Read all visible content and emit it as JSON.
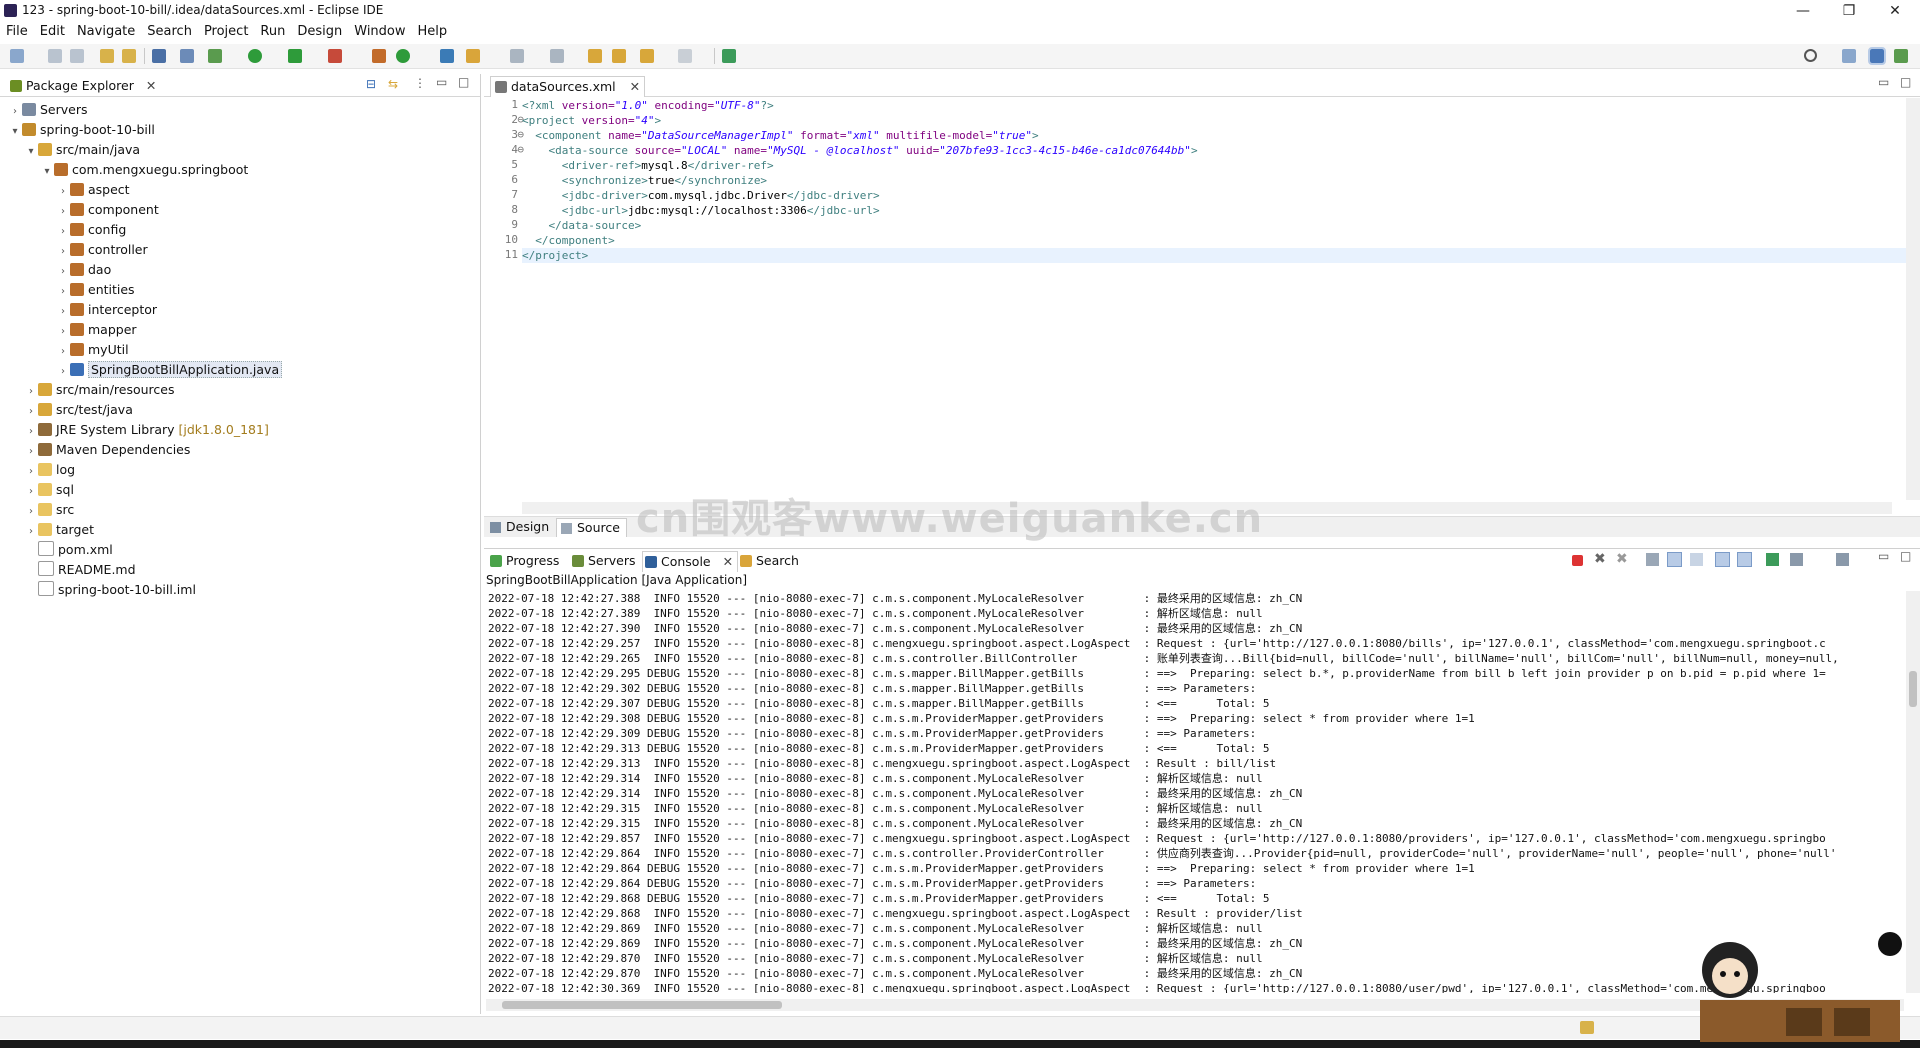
{
  "window": {
    "title": "123 - spring-boot-10-bill/.idea/dataSources.xml - Eclipse IDE"
  },
  "menu": [
    "File",
    "Edit",
    "Navigate",
    "Search",
    "Project",
    "Run",
    "Design",
    "Window",
    "Help"
  ],
  "explorer": {
    "tab": "Package Explorer",
    "items": [
      {
        "label": "Servers",
        "indent": 0,
        "arrow": "right",
        "icon": "ic-server"
      },
      {
        "label": "spring-boot-10-bill",
        "indent": 0,
        "arrow": "down",
        "icon": "ic-project"
      },
      {
        "label": "src/main/java",
        "indent": 1,
        "arrow": "down",
        "icon": "ic-srcfolder"
      },
      {
        "label": "com.mengxuegu.springboot",
        "indent": 2,
        "arrow": "down",
        "icon": "ic-package"
      },
      {
        "label": "aspect",
        "indent": 3,
        "arrow": "right",
        "icon": "ic-package"
      },
      {
        "label": "component",
        "indent": 3,
        "arrow": "right",
        "icon": "ic-package"
      },
      {
        "label": "config",
        "indent": 3,
        "arrow": "right",
        "icon": "ic-package"
      },
      {
        "label": "controller",
        "indent": 3,
        "arrow": "right",
        "icon": "ic-package"
      },
      {
        "label": "dao",
        "indent": 3,
        "arrow": "right",
        "icon": "ic-package"
      },
      {
        "label": "entities",
        "indent": 3,
        "arrow": "right",
        "icon": "ic-package"
      },
      {
        "label": "interceptor",
        "indent": 3,
        "arrow": "right",
        "icon": "ic-package"
      },
      {
        "label": "mapper",
        "indent": 3,
        "arrow": "right",
        "icon": "ic-package"
      },
      {
        "label": "myUtil",
        "indent": 3,
        "arrow": "right",
        "icon": "ic-package"
      },
      {
        "label": "SpringBootBillApplication.java",
        "indent": 3,
        "arrow": "right",
        "icon": "ic-java",
        "selected": true
      },
      {
        "label": "src/main/resources",
        "indent": 1,
        "arrow": "right",
        "icon": "ic-srcfolder"
      },
      {
        "label": "src/test/java",
        "indent": 1,
        "arrow": "right",
        "icon": "ic-srcfolder"
      },
      {
        "label": "JRE System Library",
        "decor": "[jdk1.8.0_181]",
        "indent": 1,
        "arrow": "right",
        "icon": "ic-lib"
      },
      {
        "label": "Maven Dependencies",
        "indent": 1,
        "arrow": "right",
        "icon": "ic-lib"
      },
      {
        "label": "log",
        "indent": 1,
        "arrow": "right",
        "icon": "ic-folder"
      },
      {
        "label": "sql",
        "indent": 1,
        "arrow": "right",
        "icon": "ic-folder"
      },
      {
        "label": "src",
        "indent": 1,
        "arrow": "right",
        "icon": "ic-folder"
      },
      {
        "label": "target",
        "indent": 1,
        "arrow": "right",
        "icon": "ic-folder"
      },
      {
        "label": "pom.xml",
        "indent": 1,
        "arrow": "",
        "icon": "ic-file"
      },
      {
        "label": "README.md",
        "indent": 1,
        "arrow": "",
        "icon": "ic-file"
      },
      {
        "label": "spring-boot-10-bill.iml",
        "indent": 1,
        "arrow": "",
        "icon": "ic-file"
      }
    ]
  },
  "editor": {
    "tab": "dataSources.xml",
    "line_numbers": [
      "1",
      "2",
      "3",
      "4",
      "5",
      "6",
      "7",
      "8",
      "9",
      "10",
      "11"
    ],
    "fold_markers": {
      "2": "⊖",
      "3": "⊖",
      "4": "⊖"
    },
    "lines": [
      [
        [
          "tag",
          "<?xml "
        ],
        [
          "attr",
          "version="
        ],
        [
          "val",
          "\"1.0\""
        ],
        [
          "attr",
          " encoding="
        ],
        [
          "val",
          "\"UTF-8\""
        ],
        [
          "tag",
          "?>"
        ]
      ],
      [
        [
          "tag",
          "<project "
        ],
        [
          "attr",
          "version="
        ],
        [
          "val",
          "\"4\""
        ],
        [
          "tag",
          ">"
        ]
      ],
      [
        [
          "tag",
          "  <component "
        ],
        [
          "attr",
          "name="
        ],
        [
          "val",
          "\"DataSourceManagerImpl\""
        ],
        [
          "attr",
          " format="
        ],
        [
          "val",
          "\"xml\""
        ],
        [
          "attr",
          " multifile-model="
        ],
        [
          "val",
          "\"true\""
        ],
        [
          "tag",
          ">"
        ]
      ],
      [
        [
          "tag",
          "    <data-source "
        ],
        [
          "attr",
          "source="
        ],
        [
          "val",
          "\"LOCAL\""
        ],
        [
          "attr",
          " name="
        ],
        [
          "val",
          "\"MySQL - @localhost\""
        ],
        [
          "attr",
          " uuid="
        ],
        [
          "val",
          "\"207bfe93-1cc3-4c15-b46e-ca1dc07644bb\""
        ],
        [
          "tag",
          ">"
        ]
      ],
      [
        [
          "tag",
          "      <driver-ref>"
        ],
        [
          "txt",
          "mysql.8"
        ],
        [
          "tag",
          "</driver-ref>"
        ]
      ],
      [
        [
          "tag",
          "      <synchronize>"
        ],
        [
          "txt",
          "true"
        ],
        [
          "tag",
          "</synchronize>"
        ]
      ],
      [
        [
          "tag",
          "      <jdbc-driver>"
        ],
        [
          "txt",
          "com.mysql.jdbc.Driver"
        ],
        [
          "tag",
          "</jdbc-driver>"
        ]
      ],
      [
        [
          "tag",
          "      <jdbc-url>"
        ],
        [
          "txt",
          "jdbc:mysql://localhost:3306"
        ],
        [
          "tag",
          "</jdbc-url>"
        ]
      ],
      [
        [
          "tag",
          "    </data-source>"
        ]
      ],
      [
        [
          "tag",
          "  </component>"
        ]
      ],
      [
        [
          "tag",
          "</project>"
        ]
      ]
    ],
    "bottom_tabs": [
      "Design",
      "Source"
    ]
  },
  "console": {
    "tabs": [
      "Progress",
      "Servers",
      "Console",
      "Search"
    ],
    "description": "SpringBootBillApplication [Java Application]",
    "lines": [
      "2022-07-18 12:42:27.388  INFO 15520 --- [nio-8080-exec-7] c.m.s.component.MyLocaleResolver         : 最终采用的区域信息: zh_CN",
      "2022-07-18 12:42:27.389  INFO 15520 --- [nio-8080-exec-7] c.m.s.component.MyLocaleResolver         : 解析区域信息: null",
      "2022-07-18 12:42:27.390  INFO 15520 --- [nio-8080-exec-7] c.m.s.component.MyLocaleResolver         : 最终采用的区域信息: zh_CN",
      "2022-07-18 12:42:29.257  INFO 15520 --- [nio-8080-exec-8] c.mengxuegu.springboot.aspect.LogAspect  : Request : {url='http://127.0.0.1:8080/bills', ip='127.0.0.1', classMethod='com.mengxuegu.springboot.c",
      "2022-07-18 12:42:29.265  INFO 15520 --- [nio-8080-exec-8] c.m.s.controller.BillController          : 账单列表查询...Bill{bid=null, billCode='null', billName='null', billCom='null', billNum=null, money=null,",
      "2022-07-18 12:42:29.295 DEBUG 15520 --- [nio-8080-exec-8] c.m.s.mapper.BillMapper.getBills         : ==>  Preparing: select b.*, p.providerName from bill b left join provider p on b.pid = p.pid where 1=",
      "2022-07-18 12:42:29.302 DEBUG 15520 --- [nio-8080-exec-8] c.m.s.mapper.BillMapper.getBills         : ==> Parameters: ",
      "2022-07-18 12:42:29.307 DEBUG 15520 --- [nio-8080-exec-8] c.m.s.mapper.BillMapper.getBills         : <==      Total: 5",
      "2022-07-18 12:42:29.308 DEBUG 15520 --- [nio-8080-exec-8] c.m.s.m.ProviderMapper.getProviders      : ==>  Preparing: select * from provider where 1=1",
      "2022-07-18 12:42:29.309 DEBUG 15520 --- [nio-8080-exec-8] c.m.s.m.ProviderMapper.getProviders      : ==> Parameters: ",
      "2022-07-18 12:42:29.313 DEBUG 15520 --- [nio-8080-exec-8] c.m.s.m.ProviderMapper.getProviders      : <==      Total: 5",
      "2022-07-18 12:42:29.313  INFO 15520 --- [nio-8080-exec-8] c.mengxuegu.springboot.aspect.LogAspect  : Result : bill/list",
      "2022-07-18 12:42:29.314  INFO 15520 --- [nio-8080-exec-8] c.m.s.component.MyLocaleResolver         : 解析区域信息: null",
      "2022-07-18 12:42:29.314  INFO 15520 --- [nio-8080-exec-8] c.m.s.component.MyLocaleResolver         : 最终采用的区域信息: zh_CN",
      "2022-07-18 12:42:29.315  INFO 15520 --- [nio-8080-exec-8] c.m.s.component.MyLocaleResolver         : 解析区域信息: null",
      "2022-07-18 12:42:29.315  INFO 15520 --- [nio-8080-exec-8] c.m.s.component.MyLocaleResolver         : 最终采用的区域信息: zh_CN",
      "2022-07-18 12:42:29.857  INFO 15520 --- [nio-8080-exec-7] c.mengxuegu.springboot.aspect.LogAspect  : Request : {url='http://127.0.0.1:8080/providers', ip='127.0.0.1', classMethod='com.mengxuegu.springbo",
      "2022-07-18 12:42:29.864  INFO 15520 --- [nio-8080-exec-7] c.m.s.controller.ProviderController      : 供应商列表查询...Provider{pid=null, providerCode='null', providerName='null', people='null', phone='null'",
      "2022-07-18 12:42:29.864 DEBUG 15520 --- [nio-8080-exec-7] c.m.s.m.ProviderMapper.getProviders      : ==>  Preparing: select * from provider where 1=1",
      "2022-07-18 12:42:29.864 DEBUG 15520 --- [nio-8080-exec-7] c.m.s.m.ProviderMapper.getProviders      : ==> Parameters: ",
      "2022-07-18 12:42:29.868 DEBUG 15520 --- [nio-8080-exec-7] c.m.s.m.ProviderMapper.getProviders      : <==      Total: 5",
      "2022-07-18 12:42:29.868  INFO 15520 --- [nio-8080-exec-7] c.mengxuegu.springboot.aspect.LogAspect  : Result : provider/list",
      "2022-07-18 12:42:29.869  INFO 15520 --- [nio-8080-exec-7] c.m.s.component.MyLocaleResolver         : 解析区域信息: null",
      "2022-07-18 12:42:29.869  INFO 15520 --- [nio-8080-exec-7] c.m.s.component.MyLocaleResolver         : 最终采用的区域信息: zh_CN",
      "2022-07-18 12:42:29.870  INFO 15520 --- [nio-8080-exec-7] c.m.s.component.MyLocaleResolver         : 解析区域信息: null",
      "2022-07-18 12:42:29.870  INFO 15520 --- [nio-8080-exec-7] c.m.s.component.MyLocaleResolver         : 最终采用的区域信息: zh_CN",
      "2022-07-18 12:42:30.369  INFO 15520 --- [nio-8080-exec-8] c.mengxuegu.springboot.aspect.LogAspect  : Request : {url='http://127.0.0.1:8080/user/pwd', ip='127.0.0.1', classMethod='com.mengxuegu.springboo"
    ]
  },
  "watermark": "cn围观客www.weiguanke.cn",
  "colors": {
    "xml_tag": "#3f7f7f",
    "xml_attr": "#7f007f",
    "xml_value": "#2a00ff",
    "current_line": "#e8f2fe"
  }
}
